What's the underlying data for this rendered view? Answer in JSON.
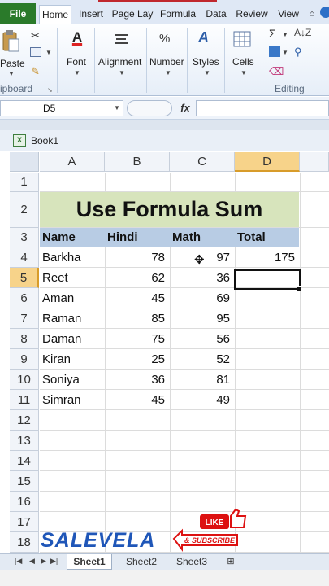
{
  "ribbon_tabs": [
    "File",
    "Home",
    "Insert",
    "Page Lay",
    "Formula",
    "Data",
    "Review",
    "View"
  ],
  "ribbon_groups": {
    "clipboard": {
      "paste_label": "Paste",
      "group_label": "ipboard"
    },
    "font": {
      "label": "Font"
    },
    "alignment": {
      "label": "Alignment"
    },
    "number": {
      "label": "Number"
    },
    "styles": {
      "label": "Styles"
    },
    "cells": {
      "label": "Cells"
    },
    "editing": {
      "label": "Editing"
    }
  },
  "formula_bar": {
    "name_box": "D5",
    "fx": "fx",
    "formula": ""
  },
  "workbook": {
    "title": "Book1",
    "icon_letter": "X"
  },
  "columns": [
    "A",
    "B",
    "C",
    "D"
  ],
  "rows": [
    "1",
    "2",
    "3",
    "4",
    "5",
    "6",
    "7",
    "8",
    "9",
    "10",
    "11",
    "12",
    "13",
    "14",
    "15",
    "16",
    "17",
    "18"
  ],
  "sheet": {
    "title": "Use Formula Sum",
    "headers": [
      "Name",
      "Hindi",
      "Math",
      "Total"
    ],
    "data": [
      [
        "Barkha",
        "78",
        "97",
        "175"
      ],
      [
        "Reet",
        "62",
        "36",
        ""
      ],
      [
        "Aman",
        "45",
        "69",
        ""
      ],
      [
        "Raman",
        "85",
        "95",
        ""
      ],
      [
        "Daman",
        "75",
        "56",
        ""
      ],
      [
        "Kiran",
        "25",
        "52",
        ""
      ],
      [
        "Soniya",
        "36",
        "81",
        ""
      ],
      [
        "Simran",
        "45",
        "49",
        ""
      ]
    ]
  },
  "sheet_tabs": [
    "Sheet1",
    "Sheet2",
    "Sheet3"
  ],
  "overlay": {
    "logo": "SALEVELA",
    "like": "LIKE",
    "subscribe": "& SUBSCRIBE"
  },
  "colors": {
    "title_fill": "#d7e4bc",
    "header_fill": "#b8cce4",
    "file_tab": "#2a7a2a",
    "active_header": "#f7d38a"
  }
}
